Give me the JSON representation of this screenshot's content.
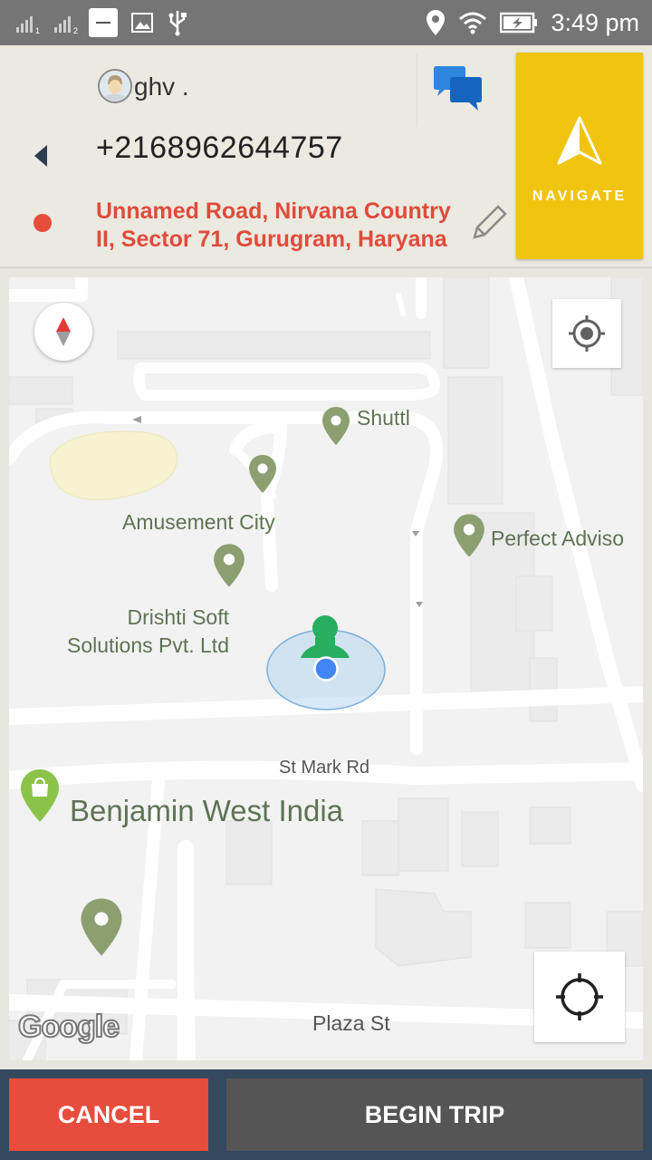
{
  "status_bar": {
    "sim1_label": "1",
    "sim2_label": "2",
    "app_icon_text": "",
    "time": "3:49 pm",
    "icons": [
      "signal-sim1-icon",
      "signal-sim2-icon",
      "app-notification-icon",
      "image-icon",
      "usb-icon",
      "location-icon",
      "wifi-icon",
      "battery-charging-icon"
    ]
  },
  "header": {
    "contact_name": "ghv .",
    "phone": "+2168962644757",
    "address": "Unnamed Road, Nirvana Country II, Sector 71, Gurugram, Haryana",
    "navigate_label": "NAVIGATE",
    "colors": {
      "address": "#e04b3b",
      "navigate_bg": "#f1c40f",
      "dot": "#e74c3c"
    }
  },
  "map": {
    "places": {
      "shuttl": "Shuttl",
      "amusement": "Amusement City",
      "perfect": "Perfect Adviso",
      "drishti": "Drishti Soft\nSolutions Pvt. Ltd",
      "benjamin": "Benjamin West India"
    },
    "streets": {
      "st_mark": "St Mark Rd",
      "plaza": "Plaza St"
    },
    "logo": "Google"
  },
  "actions": {
    "cancel": "CANCEL",
    "begin_trip": "BEGIN TRIP",
    "colors": {
      "cancel_bg": "#e74c3c",
      "begin_bg": "#555555",
      "bar_bg": "#34495e"
    }
  }
}
